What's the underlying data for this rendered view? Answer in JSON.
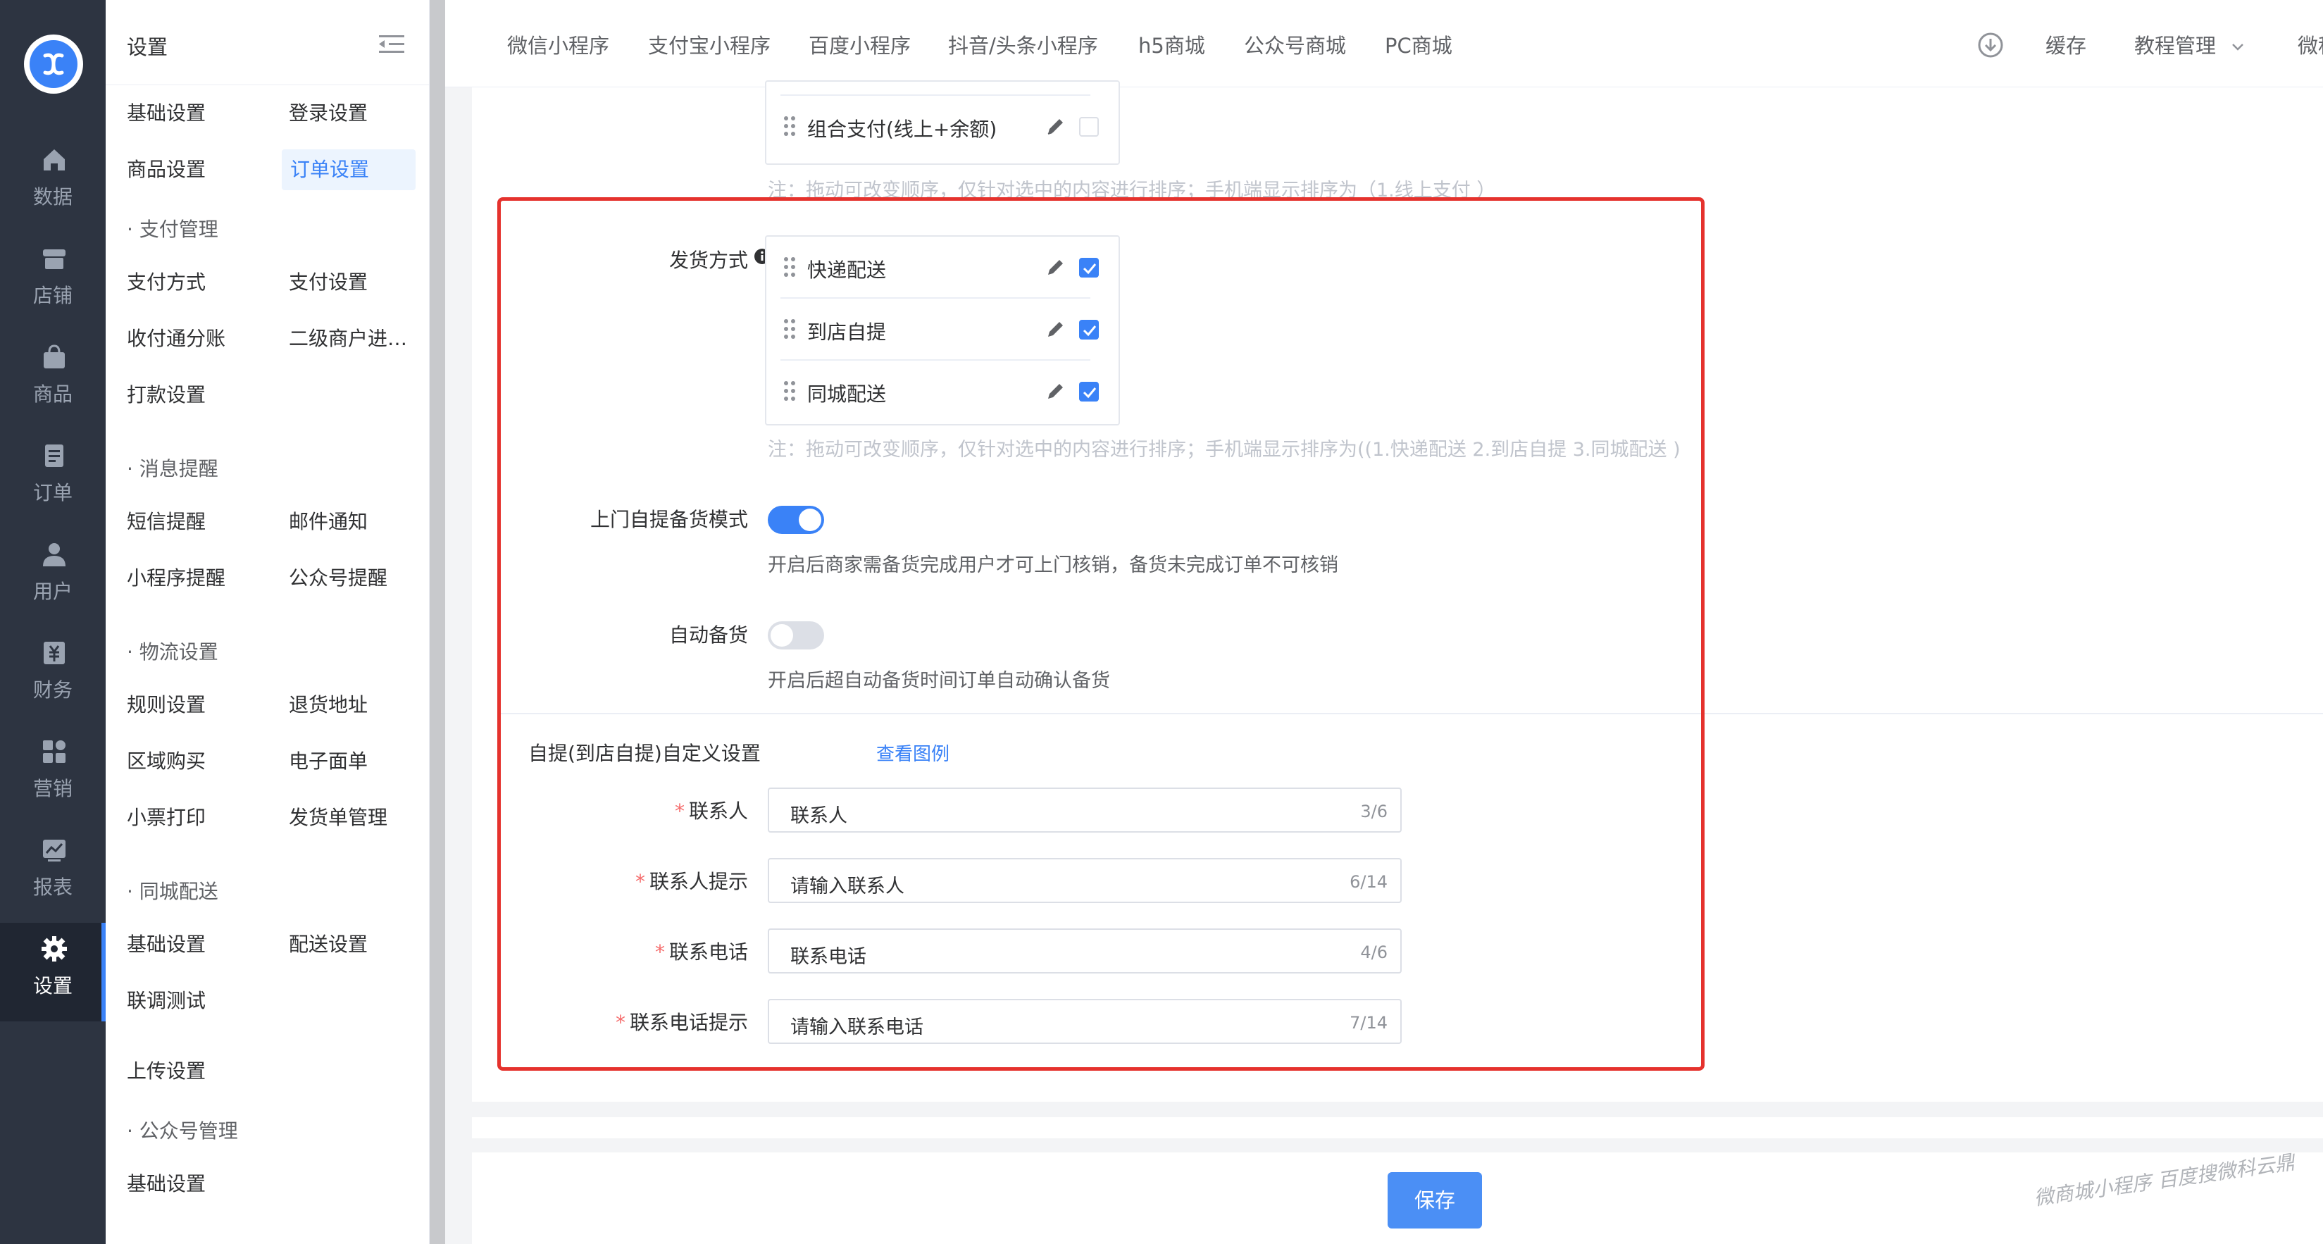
{
  "rail": {
    "items": [
      {
        "label": "数据",
        "icon": "home-icon"
      },
      {
        "label": "店铺",
        "icon": "store-icon"
      },
      {
        "label": "商品",
        "icon": "bag-icon"
      },
      {
        "label": "订单",
        "icon": "order-icon"
      },
      {
        "label": "用户",
        "icon": "user-icon"
      },
      {
        "label": "财务",
        "icon": "finance-icon"
      },
      {
        "label": "营销",
        "icon": "marketing-icon"
      },
      {
        "label": "报表",
        "icon": "report-icon"
      },
      {
        "label": "设置",
        "icon": "gear-icon",
        "active": true
      }
    ]
  },
  "submenu": {
    "title": "设置",
    "items": {
      "basic": "基础设置",
      "login": "登录设置",
      "goods": "商品设置",
      "order": "订单设置",
      "pay_group": "· 支付管理",
      "pay_method": "支付方式",
      "pay_settings": "支付设置",
      "split": "收付通分账",
      "merchant": "二级商户进…",
      "payout": "打款设置",
      "msg_group": "· 消息提醒",
      "sms": "短信提醒",
      "mail": "邮件通知",
      "mini": "小程序提醒",
      "mp": "公众号提醒",
      "logistics_group": "· 物流设置",
      "rules": "规则设置",
      "return_addr": "退货地址",
      "region": "区域购买",
      "eorder": "电子面单",
      "ticket": "小票打印",
      "ship_manage": "发货单管理",
      "city_group": "· 同城配送",
      "city_basic": "基础设置",
      "delivery": "配送设置",
      "debug": "联调测试",
      "upload": "上传设置",
      "mp_group": "· 公众号管理",
      "mp_basic": "基础设置"
    }
  },
  "topnav": {
    "tabs": [
      "微信小程序",
      "支付宝小程序",
      "百度小程序",
      "抖音/头条小程序",
      "h5商城",
      "公众号商城",
      "PC商城"
    ],
    "cache": "缓存",
    "tutorial": "教程管理",
    "overflow": "微科"
  },
  "form": {
    "combo_pay": "组合支付(线上+余额)",
    "pay_note": "注：拖动可改变顺序，仅针对选中的内容进行排序；手机端显示排序为（1.线上支付 ）",
    "ship_label": "发货方式",
    "ship_items": [
      "快递配送",
      "到店自提",
      "同城配送"
    ],
    "ship_note": "注：拖动可改变顺序，仅针对选中的内容进行排序；手机端显示排序为((1.快递配送 2.到店自提 3.同城配送 )",
    "pickup_label": "上门自提备货模式",
    "pickup_on": true,
    "pickup_hint": "开启后商家需备货完成用户才可上门核销，备货未完成订单不可核销",
    "auto_label": "自动备货",
    "auto_on": false,
    "auto_hint": "开启后超自动备货时间订单自动确认备货",
    "custom_title": "自提(到店自提)自定义设置",
    "view_example": "查看图例",
    "fields": [
      {
        "label": "联系人",
        "value": "联系人",
        "count": "3/6"
      },
      {
        "label": "联系人提示",
        "value": "请输入联系人",
        "count": "6/14"
      },
      {
        "label": "联系电话",
        "value": "联系电话",
        "count": "4/6"
      },
      {
        "label": "联系电话提示",
        "value": "请输入联系电话",
        "count": "7/14"
      }
    ],
    "required_mark": "*"
  },
  "footer": {
    "save": "保存",
    "watermark": "微商城小程序  百度搜微科云鼎"
  },
  "colors": {
    "accent": "#3a82f7",
    "rail_bg": "#2d3441",
    "highlight": "#e5322d"
  }
}
